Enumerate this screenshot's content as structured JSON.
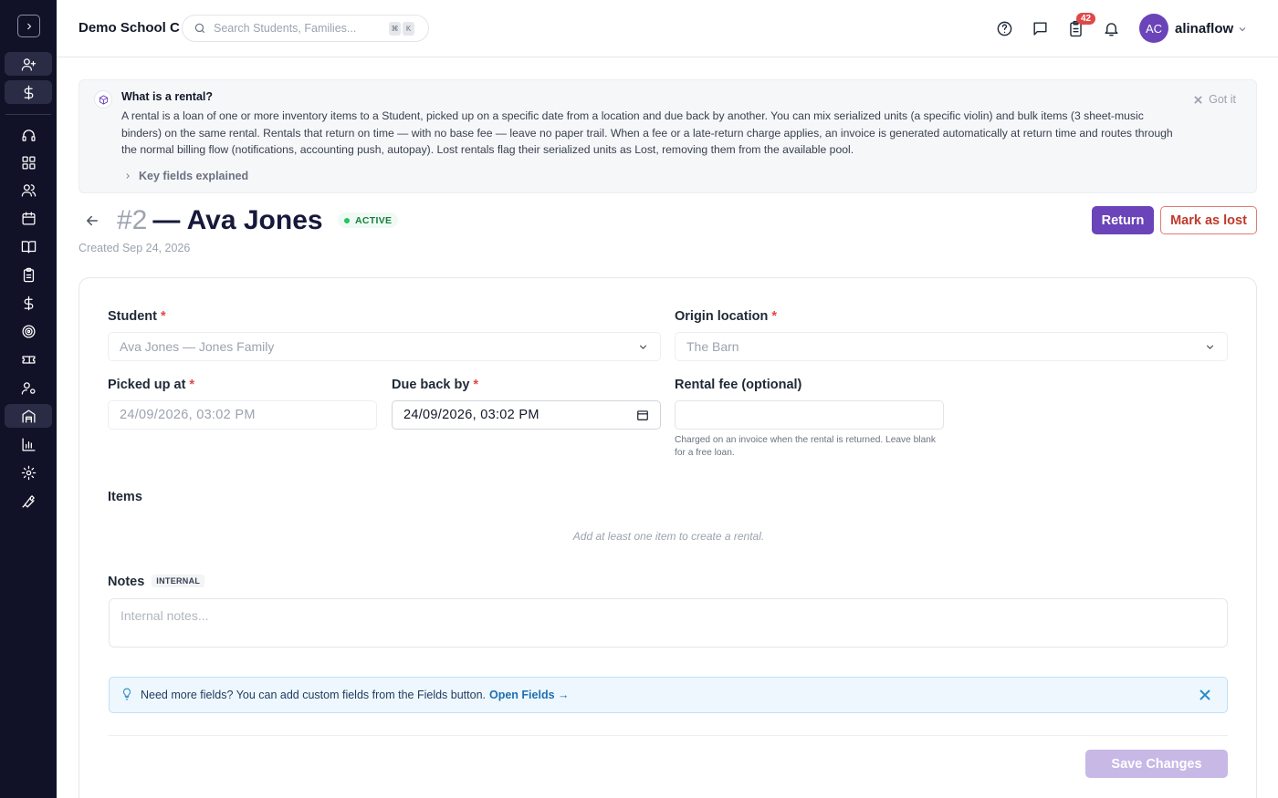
{
  "topbar": {
    "school_name": "Demo School C",
    "search_placeholder": "Search Students, Families...",
    "kbd_keys": [
      "⌘",
      "K"
    ],
    "tasks_badge": "42",
    "avatar_initials": "AC",
    "username": "alinaflow"
  },
  "sidebar": {
    "items": [
      "chevron-right-icon",
      "user-plus-icon",
      "dollar-icon",
      "headset-icon",
      "grid-icon",
      "users-icon",
      "calendar-icon",
      "book-icon",
      "clipboard-icon",
      "dollar-icon",
      "target-icon",
      "ticket-icon",
      "user-cog-icon",
      "rentals-icon",
      "bar-chart-icon",
      "settings-icon",
      "wrench-icon"
    ],
    "active": "rentals-icon"
  },
  "banner": {
    "title": "What is a rental?",
    "body": "A rental is a loan of one or more inventory items to a Student, picked up on a specific date from a location and due back by another. You can mix serialized units (a specific violin) and bulk items (3 sheet-music binders) on the same rental. Rentals that return on time — with no base fee — leave no paper trail. When a fee or a late-return charge applies, an invoice is generated automatically at return time and routes through the normal billing flow (notifications, accounting push, autopay). Lost rentals flag their serialized units as Lost, removing them from the available pool.",
    "got_it": "Got it",
    "key_fields": "Key fields explained"
  },
  "header": {
    "number": "#2",
    "name": "— Ava Jones",
    "status": "ACTIVE",
    "created": "Created Sep 24, 2026",
    "return_label": "Return",
    "lost_label": "Mark as lost"
  },
  "form": {
    "student": {
      "label": "Student",
      "value": "Ava Jones — Jones Family"
    },
    "origin": {
      "label": "Origin location",
      "value": "The Barn"
    },
    "picked_up": {
      "label": "Picked up at",
      "value": "24/09/2026, 03:02 PM"
    },
    "due_back": {
      "label": "Due back by",
      "value": "24/09/2026, 03:02 PM"
    },
    "fee": {
      "label": "Rental fee (optional)",
      "value": "",
      "helper": "Charged on an invoice when the rental is returned. Leave blank for a free loan."
    },
    "items": {
      "label": "Items",
      "empty": "Add at least one item to create a rental."
    },
    "notes": {
      "label": "Notes",
      "tag": "INTERNAL",
      "placeholder": "Internal notes..."
    },
    "tip": {
      "text": "Need more fields? You can add custom fields from the Fields button.",
      "link": "Open Fields →"
    },
    "save_label": "Save Changes"
  }
}
